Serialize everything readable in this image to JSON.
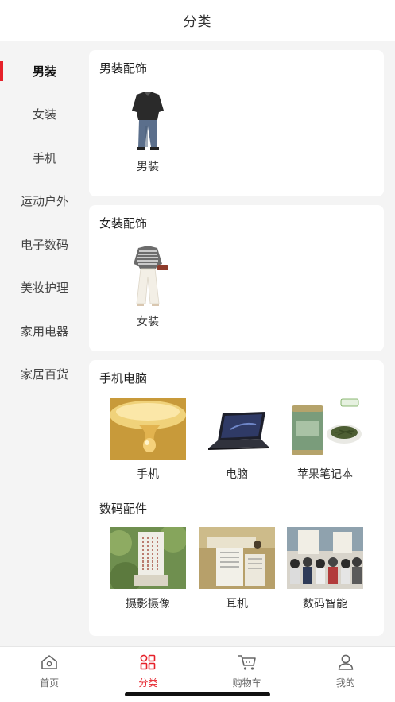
{
  "header": {
    "title": "分类"
  },
  "sidebar": {
    "items": [
      {
        "label": "男装",
        "active": true
      },
      {
        "label": "女装"
      },
      {
        "label": "手机"
      },
      {
        "label": "运动户外"
      },
      {
        "label": "电子数码"
      },
      {
        "label": "美妆护理"
      },
      {
        "label": "家用电器"
      },
      {
        "label": "家居百货"
      }
    ]
  },
  "sections": {
    "mens": {
      "title": "男装配饰",
      "items": [
        {
          "label": "男装"
        }
      ]
    },
    "womens": {
      "title": "女装配饰",
      "items": [
        {
          "label": "女装"
        }
      ]
    },
    "phone_pc": {
      "title": "手机电脑",
      "items": [
        {
          "label": "手机"
        },
        {
          "label": "电脑"
        },
        {
          "label": "苹果笔记本"
        }
      ]
    },
    "digital": {
      "title": "数码配件",
      "items": [
        {
          "label": "摄影摄像"
        },
        {
          "label": "耳机"
        },
        {
          "label": "数码智能"
        }
      ]
    }
  },
  "tabbar": {
    "items": [
      {
        "label": "首页",
        "icon": "home-icon"
      },
      {
        "label": "分类",
        "icon": "category-icon",
        "active": true
      },
      {
        "label": "购物车",
        "icon": "cart-icon"
      },
      {
        "label": "我的",
        "icon": "user-icon"
      }
    ]
  },
  "colors": {
    "accent": "#e6212a",
    "background": "#f4f4f4",
    "card": "#ffffff"
  }
}
